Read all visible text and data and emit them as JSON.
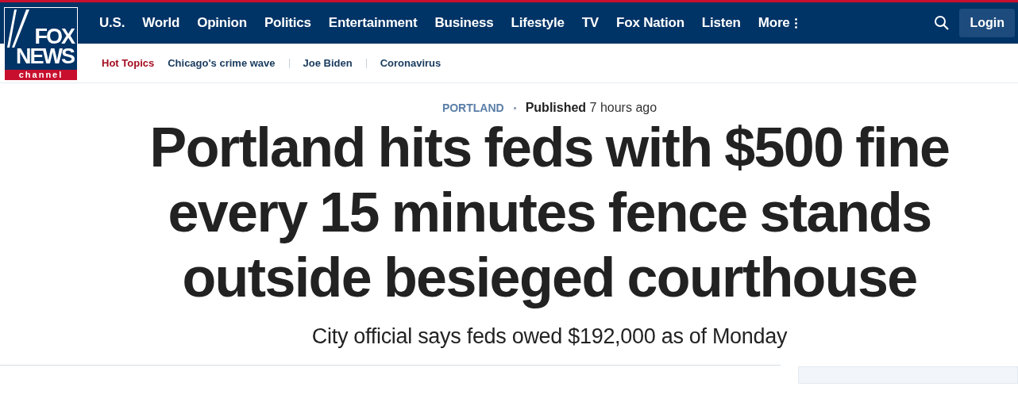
{
  "logo": {
    "line_1": "FOX",
    "line_2": "NEWS",
    "line_3": "channel"
  },
  "nav": [
    {
      "label": "U.S."
    },
    {
      "label": "World"
    },
    {
      "label": "Opinion"
    },
    {
      "label": "Politics"
    },
    {
      "label": "Entertainment"
    },
    {
      "label": "Business"
    },
    {
      "label": "Lifestyle"
    },
    {
      "label": "TV"
    },
    {
      "label": "Fox Nation"
    },
    {
      "label": "Listen"
    },
    {
      "label": "More",
      "kind": "menu"
    }
  ],
  "login": "Login",
  "hot_topics": {
    "label": "Hot Topics",
    "items": [
      "Chicago's crime wave",
      "Joe Biden",
      "Coronavirus"
    ]
  },
  "article": {
    "category": "PORTLAND",
    "published_label": "Published",
    "published_time": "7 hours ago",
    "headline": "Portland hits feds with $500 fine every 15 minutes fence stands outside besieged courthouse",
    "subheadline": "City official says feds owed $192,000 as of Monday"
  }
}
